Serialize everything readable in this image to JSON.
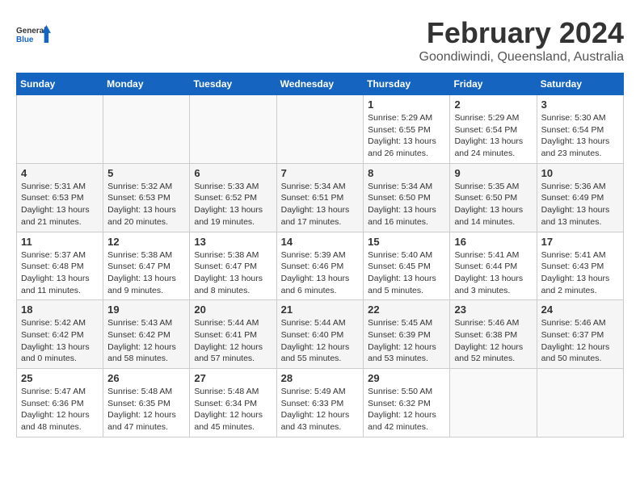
{
  "header": {
    "logo_line1": "General",
    "logo_line2": "Blue",
    "month": "February 2024",
    "location": "Goondiwindi, Queensland, Australia"
  },
  "days_of_week": [
    "Sunday",
    "Monday",
    "Tuesday",
    "Wednesday",
    "Thursday",
    "Friday",
    "Saturday"
  ],
  "weeks": [
    [
      {
        "day": "",
        "info": ""
      },
      {
        "day": "",
        "info": ""
      },
      {
        "day": "",
        "info": ""
      },
      {
        "day": "",
        "info": ""
      },
      {
        "day": "1",
        "info": "Sunrise: 5:29 AM\nSunset: 6:55 PM\nDaylight: 13 hours\nand 26 minutes."
      },
      {
        "day": "2",
        "info": "Sunrise: 5:29 AM\nSunset: 6:54 PM\nDaylight: 13 hours\nand 24 minutes."
      },
      {
        "day": "3",
        "info": "Sunrise: 5:30 AM\nSunset: 6:54 PM\nDaylight: 13 hours\nand 23 minutes."
      }
    ],
    [
      {
        "day": "4",
        "info": "Sunrise: 5:31 AM\nSunset: 6:53 PM\nDaylight: 13 hours\nand 21 minutes."
      },
      {
        "day": "5",
        "info": "Sunrise: 5:32 AM\nSunset: 6:53 PM\nDaylight: 13 hours\nand 20 minutes."
      },
      {
        "day": "6",
        "info": "Sunrise: 5:33 AM\nSunset: 6:52 PM\nDaylight: 13 hours\nand 19 minutes."
      },
      {
        "day": "7",
        "info": "Sunrise: 5:34 AM\nSunset: 6:51 PM\nDaylight: 13 hours\nand 17 minutes."
      },
      {
        "day": "8",
        "info": "Sunrise: 5:34 AM\nSunset: 6:50 PM\nDaylight: 13 hours\nand 16 minutes."
      },
      {
        "day": "9",
        "info": "Sunrise: 5:35 AM\nSunset: 6:50 PM\nDaylight: 13 hours\nand 14 minutes."
      },
      {
        "day": "10",
        "info": "Sunrise: 5:36 AM\nSunset: 6:49 PM\nDaylight: 13 hours\nand 13 minutes."
      }
    ],
    [
      {
        "day": "11",
        "info": "Sunrise: 5:37 AM\nSunset: 6:48 PM\nDaylight: 13 hours\nand 11 minutes."
      },
      {
        "day": "12",
        "info": "Sunrise: 5:38 AM\nSunset: 6:47 PM\nDaylight: 13 hours\nand 9 minutes."
      },
      {
        "day": "13",
        "info": "Sunrise: 5:38 AM\nSunset: 6:47 PM\nDaylight: 13 hours\nand 8 minutes."
      },
      {
        "day": "14",
        "info": "Sunrise: 5:39 AM\nSunset: 6:46 PM\nDaylight: 13 hours\nand 6 minutes."
      },
      {
        "day": "15",
        "info": "Sunrise: 5:40 AM\nSunset: 6:45 PM\nDaylight: 13 hours\nand 5 minutes."
      },
      {
        "day": "16",
        "info": "Sunrise: 5:41 AM\nSunset: 6:44 PM\nDaylight: 13 hours\nand 3 minutes."
      },
      {
        "day": "17",
        "info": "Sunrise: 5:41 AM\nSunset: 6:43 PM\nDaylight: 13 hours\nand 2 minutes."
      }
    ],
    [
      {
        "day": "18",
        "info": "Sunrise: 5:42 AM\nSunset: 6:42 PM\nDaylight: 13 hours\nand 0 minutes."
      },
      {
        "day": "19",
        "info": "Sunrise: 5:43 AM\nSunset: 6:42 PM\nDaylight: 12 hours\nand 58 minutes."
      },
      {
        "day": "20",
        "info": "Sunrise: 5:44 AM\nSunset: 6:41 PM\nDaylight: 12 hours\nand 57 minutes."
      },
      {
        "day": "21",
        "info": "Sunrise: 5:44 AM\nSunset: 6:40 PM\nDaylight: 12 hours\nand 55 minutes."
      },
      {
        "day": "22",
        "info": "Sunrise: 5:45 AM\nSunset: 6:39 PM\nDaylight: 12 hours\nand 53 minutes."
      },
      {
        "day": "23",
        "info": "Sunrise: 5:46 AM\nSunset: 6:38 PM\nDaylight: 12 hours\nand 52 minutes."
      },
      {
        "day": "24",
        "info": "Sunrise: 5:46 AM\nSunset: 6:37 PM\nDaylight: 12 hours\nand 50 minutes."
      }
    ],
    [
      {
        "day": "25",
        "info": "Sunrise: 5:47 AM\nSunset: 6:36 PM\nDaylight: 12 hours\nand 48 minutes."
      },
      {
        "day": "26",
        "info": "Sunrise: 5:48 AM\nSunset: 6:35 PM\nDaylight: 12 hours\nand 47 minutes."
      },
      {
        "day": "27",
        "info": "Sunrise: 5:48 AM\nSunset: 6:34 PM\nDaylight: 12 hours\nand 45 minutes."
      },
      {
        "day": "28",
        "info": "Sunrise: 5:49 AM\nSunset: 6:33 PM\nDaylight: 12 hours\nand 43 minutes."
      },
      {
        "day": "29",
        "info": "Sunrise: 5:50 AM\nSunset: 6:32 PM\nDaylight: 12 hours\nand 42 minutes."
      },
      {
        "day": "",
        "info": ""
      },
      {
        "day": "",
        "info": ""
      }
    ]
  ]
}
